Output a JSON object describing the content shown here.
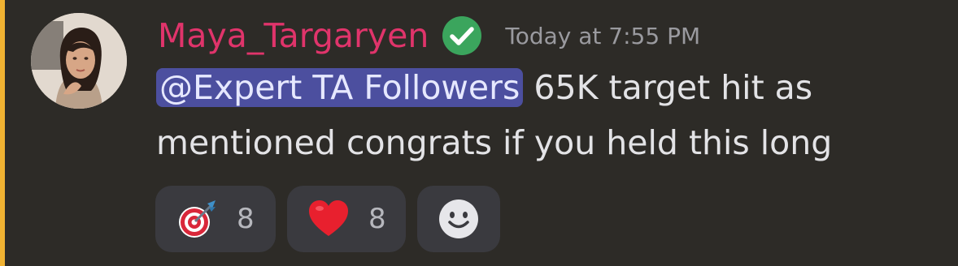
{
  "message": {
    "username": "Maya_Targaryen",
    "timestamp": "Today at 7:55 PM",
    "mention": "@Expert TA Followers",
    "text_line1": " 65K target hit as",
    "text_line2": "mentioned congrats if you held this long"
  },
  "reactions": [
    {
      "icon": "target-dart-icon",
      "count": "8"
    },
    {
      "icon": "red-heart-icon",
      "count": "8"
    }
  ],
  "colors": {
    "username": "#e0346b",
    "verified": "#3ba55d",
    "mention_bg": "#4c4f9f",
    "accent_bar": "#f0b232",
    "background": "#2d2b27"
  }
}
